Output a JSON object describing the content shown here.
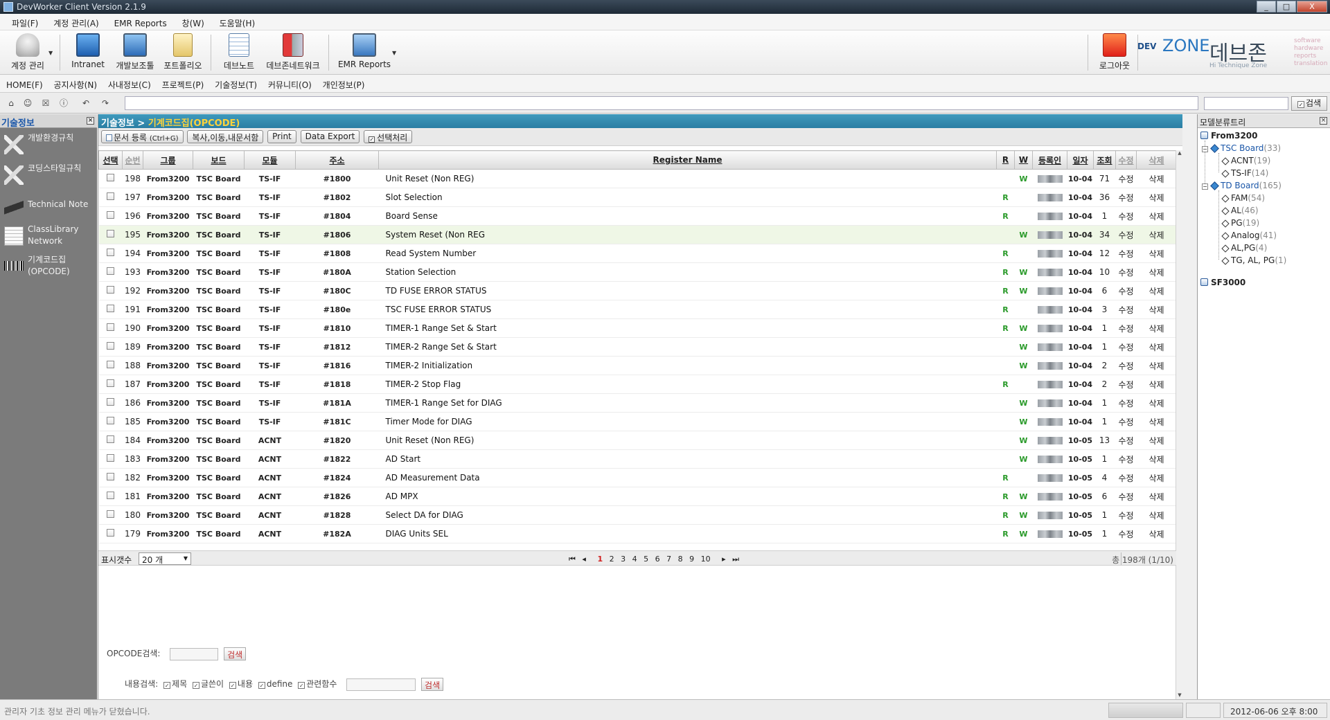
{
  "window": {
    "title": "DevWorker Client Version 2.1.9",
    "buttons": [
      "_",
      "□",
      "X"
    ]
  },
  "menubar": [
    "파일(F)",
    "계정 관리(A)",
    "EMR Reports",
    "창(W)",
    "도움말(H)"
  ],
  "toolbar": {
    "account": "계정 관리",
    "intranet": "Intranet",
    "dev_helper": "개발보조툴",
    "portfolio": "포트폴리오",
    "devnote": "데브노트",
    "devzone_network": "데브존네트워크",
    "emr_reports": "EMR Reports",
    "logout": "로그아웃"
  },
  "logo": {
    "dev": "DEV",
    "zone": "ZONE",
    "kr": "데브존",
    "sub": "Hi Technique Zone",
    "side": [
      "software",
      "hardware",
      "reports",
      "translation"
    ]
  },
  "navmenu": [
    "HOME(F)",
    "공지사항(N)",
    "사내정보(C)",
    "프로젝트(P)",
    "기술정보(T)",
    "커뮤니티(O)",
    "개인정보(P)"
  ],
  "addressbar": {
    "search_label": "검색"
  },
  "leftpanel": {
    "title": "기술정보",
    "items": [
      {
        "label": "개발환경규칙"
      },
      {
        "label": "코딩스타일규칙"
      },
      {
        "label": "Technical Note"
      },
      {
        "label": "ClassLibrary Network"
      },
      {
        "label": "기계코드집 (OPCODE)"
      }
    ]
  },
  "main": {
    "breadcrumb_root": "기술정보",
    "breadcrumb_sep": ">",
    "breadcrumb_current": "기계코드집(OPCODE)",
    "actions": {
      "register": "문서 등록",
      "register_key": "(Ctrl+G)",
      "copy": "복사,이동,내문서함",
      "print": "Print",
      "export": "Data Export",
      "select": "선택처리"
    }
  },
  "grid": {
    "headers": [
      "선택",
      "순번",
      "그룹",
      "보드",
      "모듈",
      "주소",
      "Register Name",
      "R",
      "W",
      "등록인",
      "일자",
      "조회",
      "수정",
      "삭제"
    ],
    "rows": [
      {
        "no": "198",
        "group": "From3200",
        "board": "TSC Board",
        "module": "TS-IF",
        "addr": "#1800",
        "name": "Unit Reset  (Non REG)",
        "r": "",
        "w": "W",
        "date": "10-04",
        "views": "71",
        "edit": "수정",
        "del": "삭제"
      },
      {
        "no": "197",
        "group": "From3200",
        "board": "TSC Board",
        "module": "TS-IF",
        "addr": "#1802",
        "name": "Slot Selection",
        "r": "R",
        "w": "",
        "date": "10-04",
        "views": "36",
        "edit": "수정",
        "del": "삭제"
      },
      {
        "no": "196",
        "group": "From3200",
        "board": "TSC Board",
        "module": "TS-IF",
        "addr": "#1804",
        "name": "Board Sense",
        "r": "R",
        "w": "",
        "date": "10-04",
        "views": "1",
        "edit": "수정",
        "del": "삭제"
      },
      {
        "no": "195",
        "group": "From3200",
        "board": "TSC Board",
        "module": "TS-IF",
        "addr": "#1806",
        "name": "System Reset  (Non REG",
        "r": "",
        "w": "W",
        "date": "10-04",
        "views": "34",
        "edit": "수정",
        "del": "삭제"
      },
      {
        "no": "194",
        "group": "From3200",
        "board": "TSC Board",
        "module": "TS-IF",
        "addr": "#1808",
        "name": "Read System Number",
        "r": "R",
        "w": "",
        "date": "10-04",
        "views": "12",
        "edit": "수정",
        "del": "삭제"
      },
      {
        "no": "193",
        "group": "From3200",
        "board": "TSC Board",
        "module": "TS-IF",
        "addr": "#180A",
        "name": "Station Selection",
        "r": "R",
        "w": "W",
        "date": "10-04",
        "views": "10",
        "edit": "수정",
        "del": "삭제"
      },
      {
        "no": "192",
        "group": "From3200",
        "board": "TSC Board",
        "module": "TS-IF",
        "addr": "#180C",
        "name": "TD FUSE ERROR STATUS",
        "r": "R",
        "w": "W",
        "date": "10-04",
        "views": "6",
        "edit": "수정",
        "del": "삭제"
      },
      {
        "no": "191",
        "group": "From3200",
        "board": "TSC Board",
        "module": "TS-IF",
        "addr": "#180e",
        "name": "TSC FUSE ERROR STATUS",
        "r": "R",
        "w": "",
        "date": "10-04",
        "views": "3",
        "edit": "수정",
        "del": "삭제"
      },
      {
        "no": "190",
        "group": "From3200",
        "board": "TSC Board",
        "module": "TS-IF",
        "addr": "#1810",
        "name": "TIMER-1 Range Set & Start",
        "r": "R",
        "w": "W",
        "date": "10-04",
        "views": "1",
        "edit": "수정",
        "del": "삭제"
      },
      {
        "no": "189",
        "group": "From3200",
        "board": "TSC Board",
        "module": "TS-IF",
        "addr": "#1812",
        "name": "TIMER-2 Range Set & Start",
        "r": "",
        "w": "W",
        "date": "10-04",
        "views": "1",
        "edit": "수정",
        "del": "삭제"
      },
      {
        "no": "188",
        "group": "From3200",
        "board": "TSC Board",
        "module": "TS-IF",
        "addr": "#1816",
        "name": "TIMER-2 Initialization",
        "r": "",
        "w": "W",
        "date": "10-04",
        "views": "2",
        "edit": "수정",
        "del": "삭제"
      },
      {
        "no": "187",
        "group": "From3200",
        "board": "TSC Board",
        "module": "TS-IF",
        "addr": "#1818",
        "name": "TIMER-2 Stop Flag",
        "r": "R",
        "w": "",
        "date": "10-04",
        "views": "2",
        "edit": "수정",
        "del": "삭제"
      },
      {
        "no": "186",
        "group": "From3200",
        "board": "TSC Board",
        "module": "TS-IF",
        "addr": "#181A",
        "name": "TIMER-1 Range Set for DIAG",
        "r": "",
        "w": "W",
        "date": "10-04",
        "views": "1",
        "edit": "수정",
        "del": "삭제"
      },
      {
        "no": "185",
        "group": "From3200",
        "board": "TSC Board",
        "module": "TS-IF",
        "addr": "#181C",
        "name": "Timer Mode for DIAG",
        "r": "",
        "w": "W",
        "date": "10-04",
        "views": "1",
        "edit": "수정",
        "del": "삭제"
      },
      {
        "no": "184",
        "group": "From3200",
        "board": "TSC Board",
        "module": "ACNT",
        "addr": "#1820",
        "name": "Unit Reset (Non REG)",
        "r": "",
        "w": "W",
        "date": "10-05",
        "views": "13",
        "edit": "수정",
        "del": "삭제"
      },
      {
        "no": "183",
        "group": "From3200",
        "board": "TSC Board",
        "module": "ACNT",
        "addr": "#1822",
        "name": "AD Start",
        "r": "",
        "w": "W",
        "date": "10-05",
        "views": "1",
        "edit": "수정",
        "del": "삭제"
      },
      {
        "no": "182",
        "group": "From3200",
        "board": "TSC Board",
        "module": "ACNT",
        "addr": "#1824",
        "name": "AD Measurement Data",
        "r": "R",
        "w": "",
        "date": "10-05",
        "views": "4",
        "edit": "수정",
        "del": "삭제"
      },
      {
        "no": "181",
        "group": "From3200",
        "board": "TSC Board",
        "module": "ACNT",
        "addr": "#1826",
        "name": "AD MPX",
        "r": "R",
        "w": "W",
        "date": "10-05",
        "views": "6",
        "edit": "수정",
        "del": "삭제"
      },
      {
        "no": "180",
        "group": "From3200",
        "board": "TSC Board",
        "module": "ACNT",
        "addr": "#1828",
        "name": "Select DA for DIAG",
        "r": "R",
        "w": "W",
        "date": "10-05",
        "views": "1",
        "edit": "수정",
        "del": "삭제"
      },
      {
        "no": "179",
        "group": "From3200",
        "board": "TSC Board",
        "module": "ACNT",
        "addr": "#182A",
        "name": "DIAG Units SEL",
        "r": "R",
        "w": "W",
        "date": "10-05",
        "views": "1",
        "edit": "수정",
        "del": "삭제"
      }
    ]
  },
  "pager": {
    "label": "표시갯수",
    "page_size": "20 개",
    "first": "⏮",
    "prev": "◂",
    "pages": [
      "1",
      "2",
      "3",
      "4",
      "5",
      "6",
      "7",
      "8",
      "9",
      "10"
    ],
    "next": "▸",
    "last": "⏭",
    "total": "총 198개 (1/10)"
  },
  "search": {
    "opcode_label": "OPCODE검색:",
    "button": "검색",
    "content_label": "내용검색:",
    "options": [
      "제목",
      "글쓴이",
      "내용",
      "define",
      "관련함수"
    ]
  },
  "rightpanel": {
    "title": "모델분류트리",
    "tree": {
      "root1": "From3200",
      "tsc_board": "TSC Board",
      "tsc_board_count": "(33)",
      "acnt": "ACNT",
      "acnt_count": "(19)",
      "tsif": "TS-IF",
      "tsif_count": "(14)",
      "td_board": "TD Board",
      "td_board_count": "(165)",
      "fam": "FAM",
      "fam_count": "(54)",
      "al": "AL",
      "al_count": "(46)",
      "pg": "PG",
      "pg_count": "(19)",
      "analog": "Analog",
      "analog_count": "(41)",
      "alpg": "AL,PG",
      "alpg_count": "(4)",
      "tgalpg": "TG, AL, PG",
      "tgalpg_count": "(1)",
      "root2": "SF3000"
    }
  },
  "statusbar": {
    "message": "관리자 기초 정보 관리 메뉴가 닫혔습니다.",
    "datetime": "2012-06-06 오후 8:00"
  }
}
